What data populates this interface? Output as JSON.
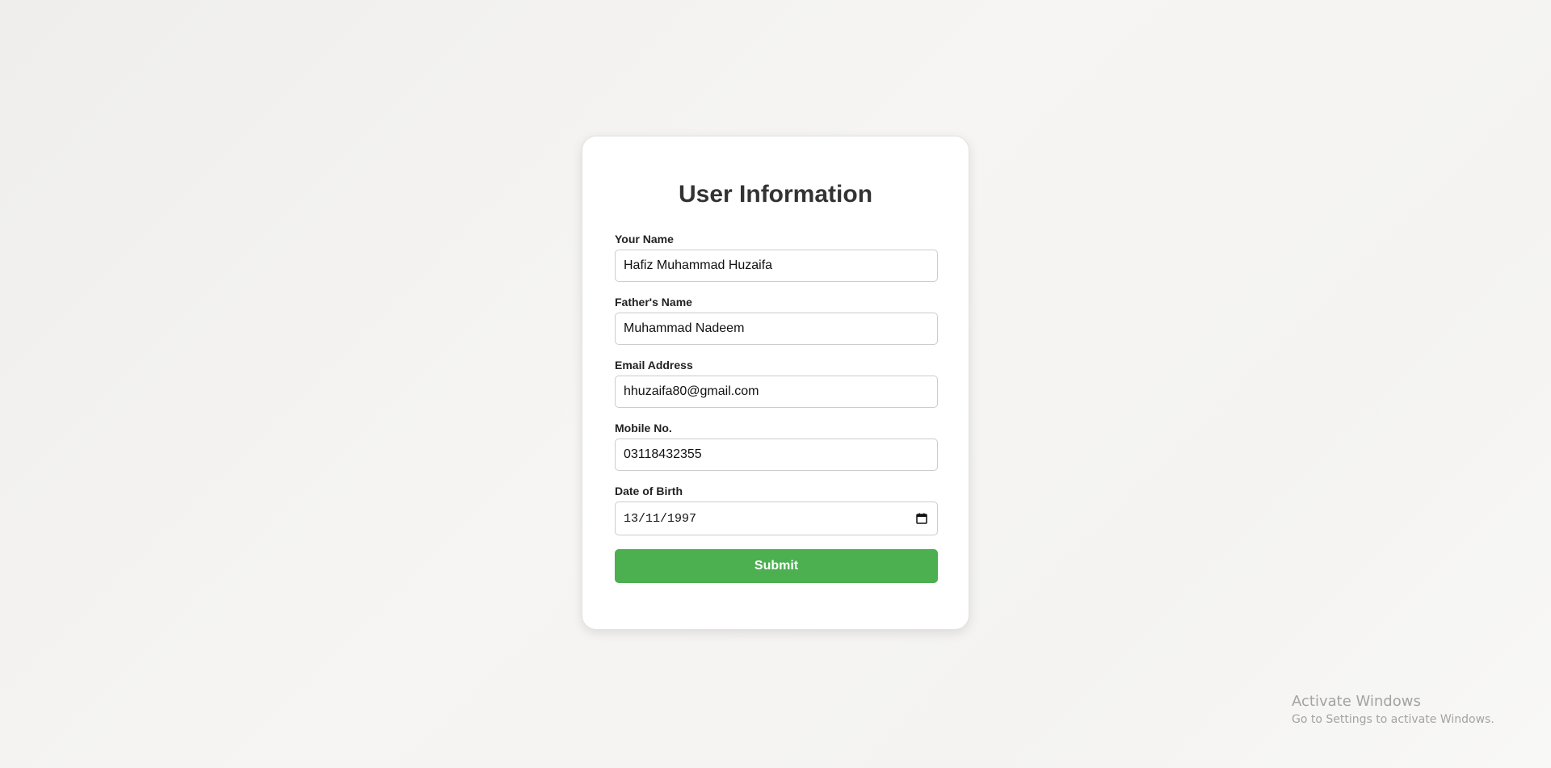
{
  "form": {
    "title": "User Information",
    "fields": [
      {
        "label": "Your Name",
        "value": "Hafiz Muhammad Huzaifa"
      },
      {
        "label": "Father's Name",
        "value": "Muhammad Nadeem"
      },
      {
        "label": "Email Address",
        "value": "hhuzaifa80@gmail.com"
      },
      {
        "label": "Mobile No.",
        "value": "03118432355"
      },
      {
        "label": "Date of Birth",
        "value": "13/11/1997",
        "icon": "calendar-icon"
      }
    ],
    "submit_label": "Submit",
    "submit_color": "#4caf50"
  },
  "watermark": {
    "title": "Activate Windows",
    "subtitle": "Go to Settings to activate Windows."
  }
}
